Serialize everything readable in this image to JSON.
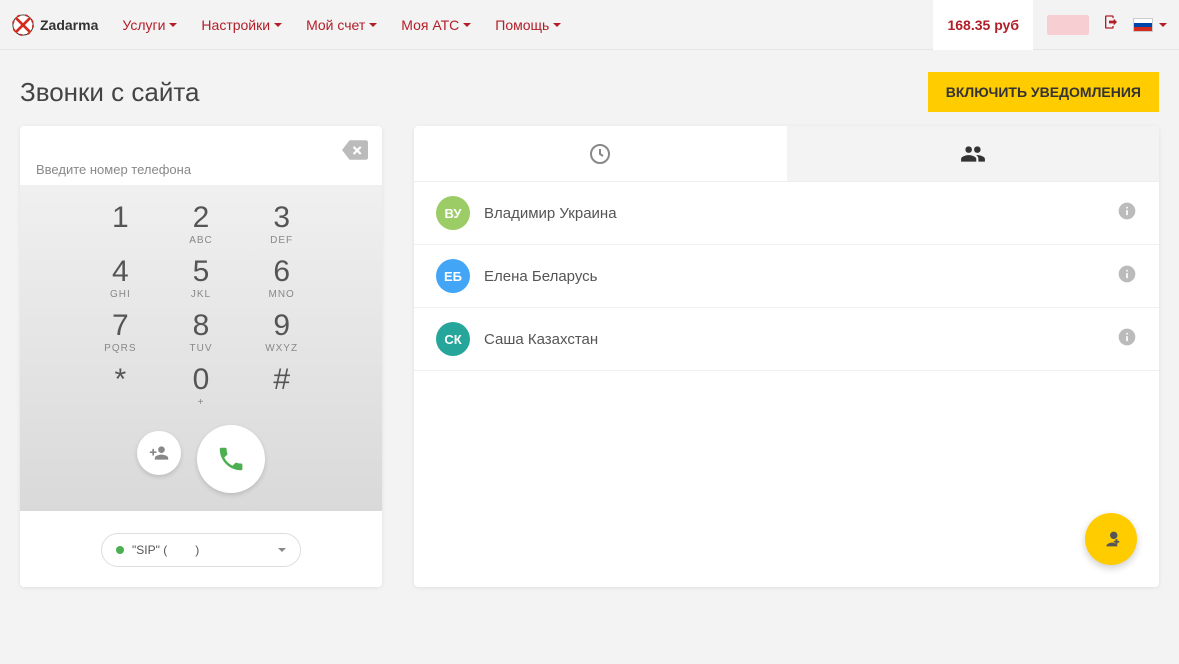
{
  "brand": "Zadarma",
  "nav": {
    "services": "Услуги",
    "settings": "Настройки",
    "account": "Мой счет",
    "pbx": "Моя АТС",
    "help": "Помощь"
  },
  "balance": "168.35 руб",
  "page_title": "Звонки с сайта",
  "notif_button": "ВКЛЮЧИТЬ УВЕДОМЛЕНИЯ",
  "dialer": {
    "placeholder": "Введите номер телефона",
    "keys": {
      "k1": {
        "d": "1",
        "l": ""
      },
      "k2": {
        "d": "2",
        "l": "ABC"
      },
      "k3": {
        "d": "3",
        "l": "DEF"
      },
      "k4": {
        "d": "4",
        "l": "GHI"
      },
      "k5": {
        "d": "5",
        "l": "JKL"
      },
      "k6": {
        "d": "6",
        "l": "MNO"
      },
      "k7": {
        "d": "7",
        "l": "PQRS"
      },
      "k8": {
        "d": "8",
        "l": "TUV"
      },
      "k9": {
        "d": "9",
        "l": "WXYZ"
      },
      "kstar": {
        "d": "*",
        "l": ""
      },
      "k0": {
        "d": "0",
        "l": "+"
      },
      "khash": {
        "d": "#",
        "l": ""
      }
    },
    "sip_label_prefix": "\"SIP\" (",
    "sip_label_suffix": ")",
    "sip_hidden": "     "
  },
  "contacts": [
    {
      "initials": "ВУ",
      "name": "Владимир Украина",
      "color": "#9ccc65"
    },
    {
      "initials": "ЕБ",
      "name": "Елена Беларусь",
      "color": "#42a5f5"
    },
    {
      "initials": "СК",
      "name": "Саша Казахстан",
      "color": "#26a69a"
    }
  ]
}
